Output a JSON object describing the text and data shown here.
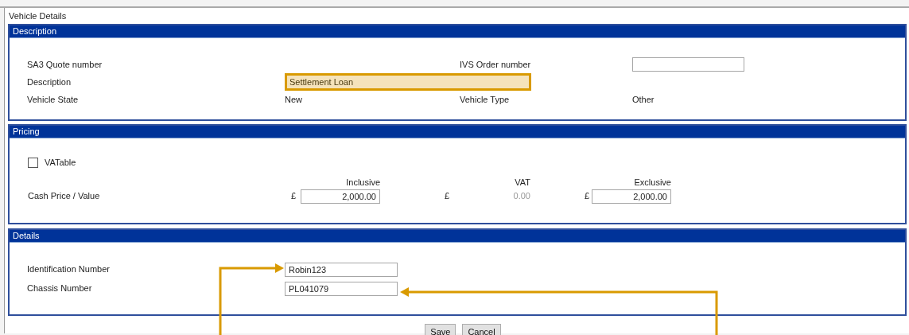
{
  "window": {
    "title": "Vehicle Details"
  },
  "description": {
    "title": "Description",
    "rows": [
      {
        "label": "SA3 Quote number",
        "label_2": "IVS Order number",
        "value_2": {
          "kind": "input"
        }
      },
      {
        "label": "Description",
        "value": {
          "kind": "input",
          "text": "Settlement Loan",
          "highlighted": true
        }
      },
      {
        "label": "Vehicle State",
        "value": {
          "kind": "text",
          "text": "New"
        },
        "label_2": "Vehicle Type",
        "value_2": {
          "kind": "text",
          "text": "Other"
        }
      }
    ]
  },
  "pricing": {
    "title": "Pricing",
    "vatable": {
      "label": "VATable",
      "checked": false
    },
    "columns": [
      "Inclusive",
      "VAT",
      "Exclusive"
    ],
    "row": {
      "label": "Cash Price / Value",
      "cells": [
        {
          "currency": "£",
          "kind": "input",
          "text": "2,000.00"
        },
        {
          "currency": "£",
          "kind": "text",
          "text": "0.00"
        },
        {
          "currency": "£",
          "kind": "input",
          "text": "2,000.00"
        }
      ]
    }
  },
  "details": {
    "title": "Details",
    "rows": [
      {
        "label": "Identification Number",
        "value": "Robin123"
      },
      {
        "label": "Chassis Number",
        "value": "PL041079"
      }
    ]
  },
  "buttons": [
    "Save",
    "Cancel"
  ]
}
